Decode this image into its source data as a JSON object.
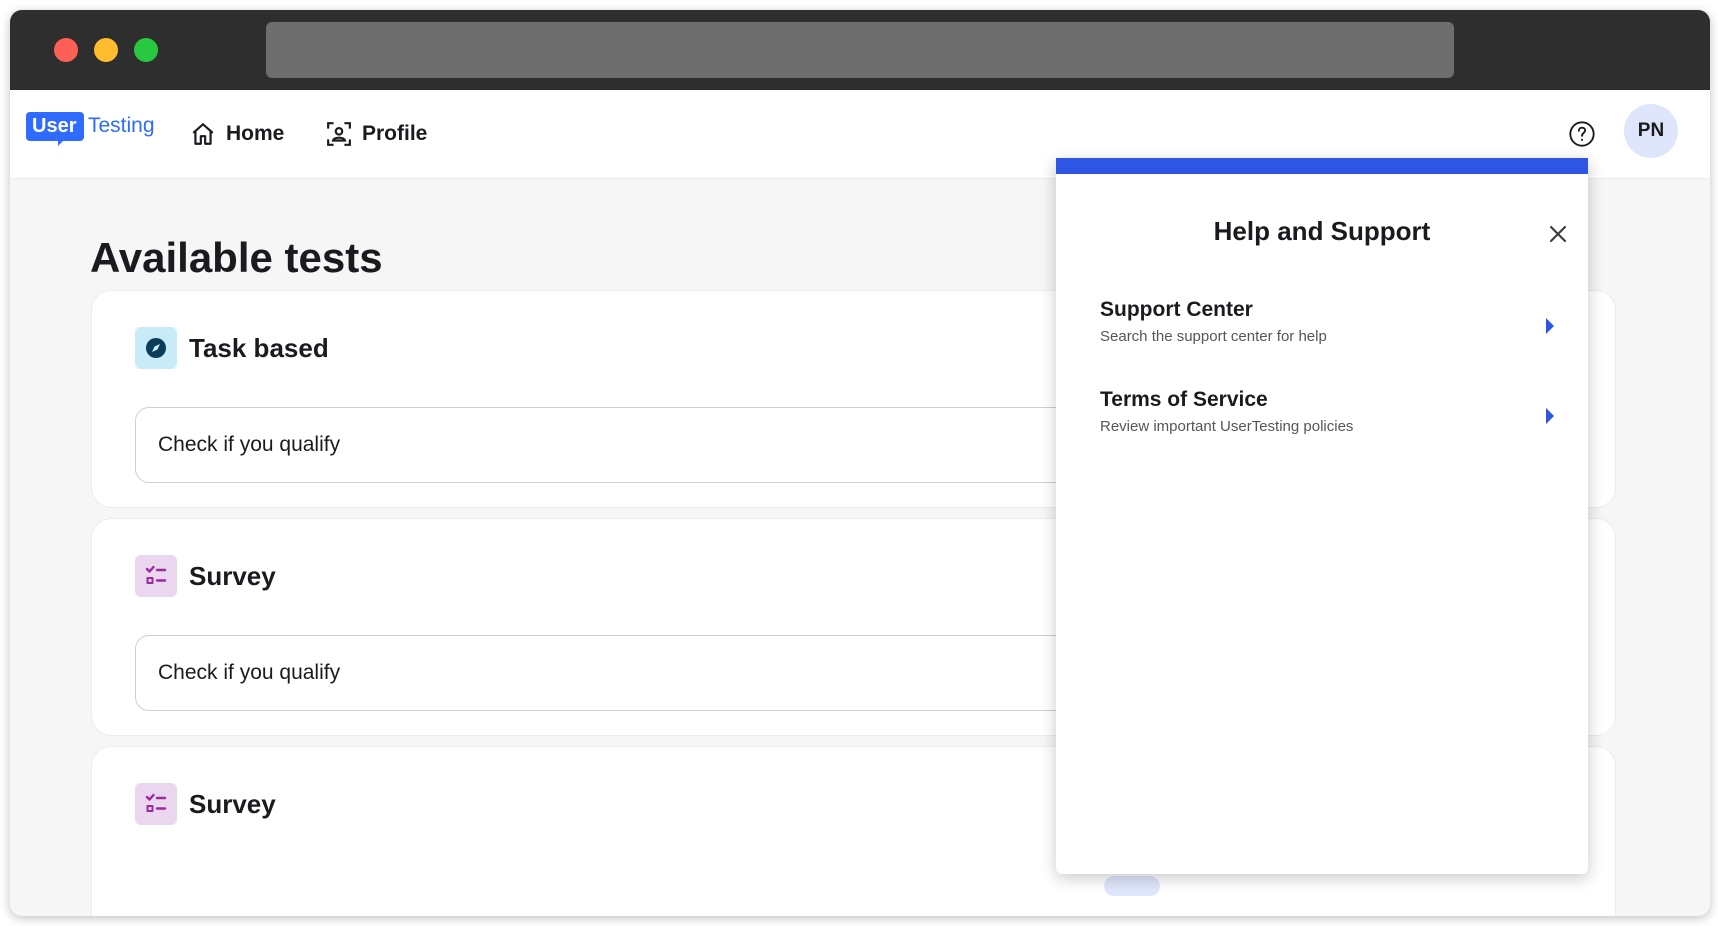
{
  "brand": {
    "logo_part1": "User",
    "logo_part2": "Testing",
    "accent_color": "#2f6bff"
  },
  "navbar": {
    "home_label": "Home",
    "home_icon": "home-icon",
    "profile_label": "Profile",
    "profile_icon": "profile-icon",
    "help_icon": "help-circle-icon",
    "avatar_initials": "PN"
  },
  "main": {
    "title": "Available tests",
    "cards": [
      {
        "type": "Task based",
        "icon": "compass-icon",
        "action": "Check if you qualify"
      },
      {
        "type": "Survey",
        "icon": "checklist-icon",
        "action": "Check if you qualify"
      },
      {
        "type": "Survey",
        "icon": "checklist-icon"
      }
    ]
  },
  "help_panel": {
    "title": "Help and Support",
    "close_icon": "close-icon",
    "bar_color": "#2f55e4",
    "items": [
      {
        "title": "Support Center",
        "subtitle": "Search the support center for help"
      },
      {
        "title": "Terms of Service",
        "subtitle": "Review important UserTesting policies"
      }
    ]
  }
}
